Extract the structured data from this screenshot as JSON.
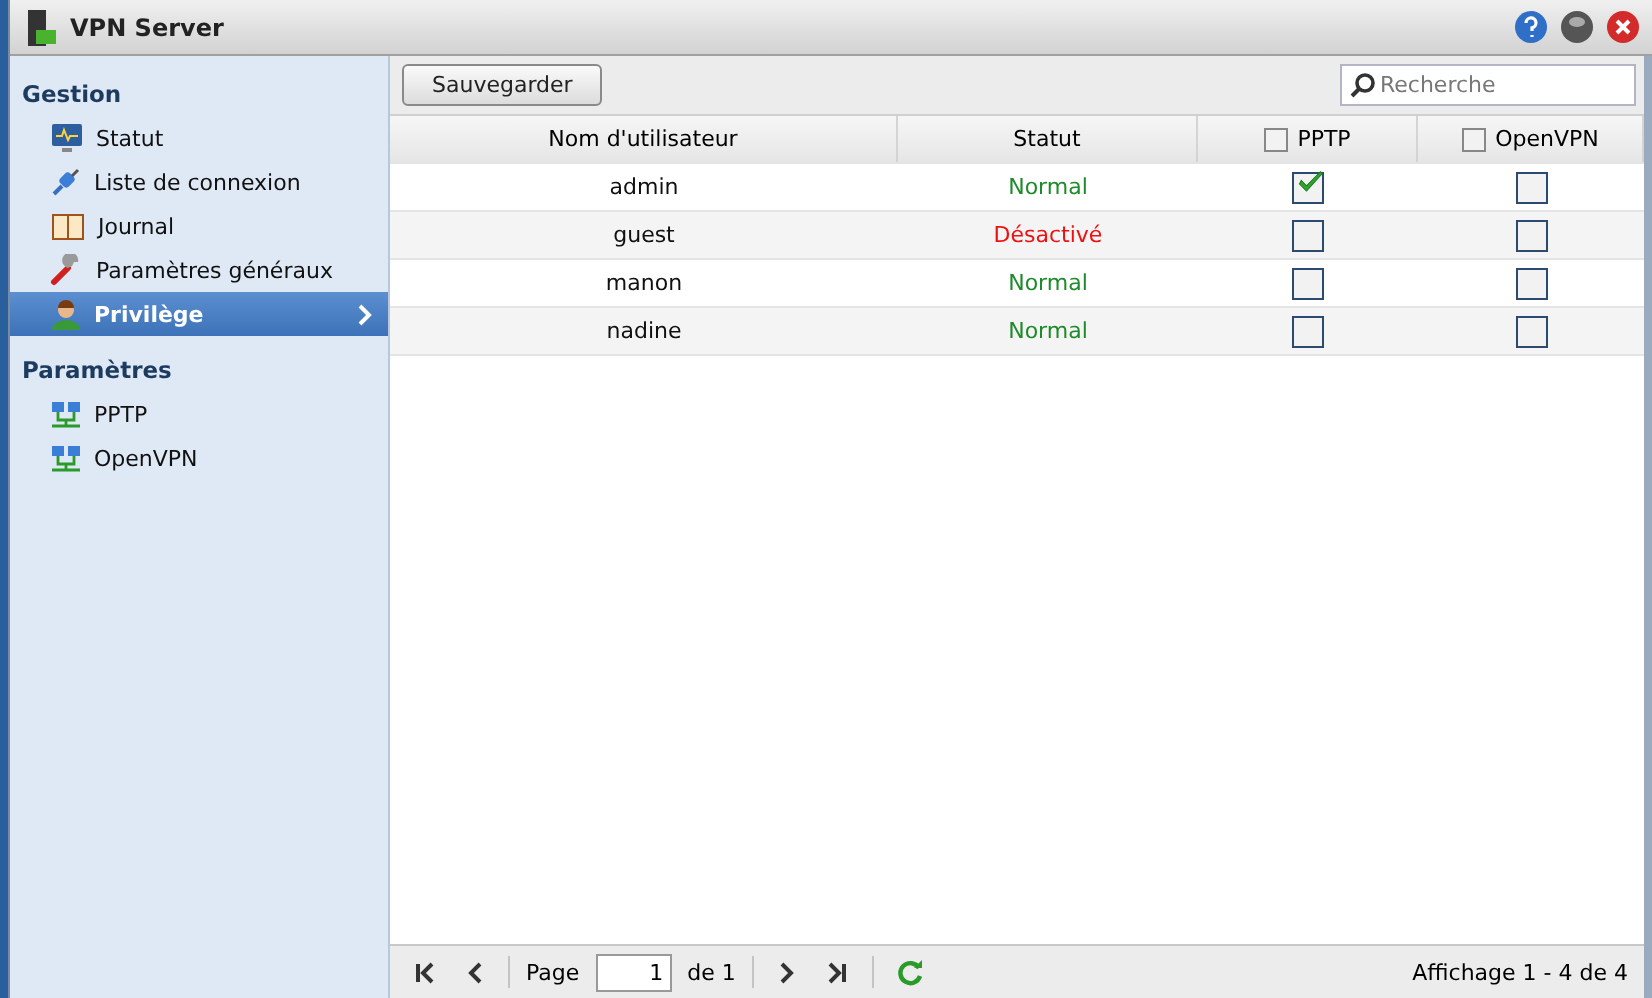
{
  "window": {
    "title": "VPN Server"
  },
  "sidebar": {
    "sections": [
      {
        "title": "Gestion",
        "items": [
          {
            "label": "Statut",
            "kind": "monitor",
            "selected": false
          },
          {
            "label": "Liste de connexion",
            "kind": "plug",
            "selected": false
          },
          {
            "label": "Journal",
            "kind": "book",
            "selected": false
          },
          {
            "label": "Paramètres généraux",
            "kind": "wrench",
            "selected": false
          },
          {
            "label": "Privilège",
            "kind": "user",
            "selected": true
          }
        ]
      },
      {
        "title": "Paramètres",
        "items": [
          {
            "label": "PPTP",
            "kind": "network",
            "selected": false
          },
          {
            "label": "OpenVPN",
            "kind": "network",
            "selected": false
          }
        ]
      }
    ]
  },
  "toolbar": {
    "save": "Sauvegarder",
    "search": {
      "placeholder": "Recherche"
    }
  },
  "table": {
    "columns": [
      {
        "label": "Nom d'utilisateur",
        "kind": "text"
      },
      {
        "label": "Statut",
        "kind": "text"
      },
      {
        "label": "PPTP",
        "kind": "check",
        "checked": false
      },
      {
        "label": "OpenVPN",
        "kind": "check",
        "checked": false
      }
    ],
    "rows": [
      {
        "user": "admin",
        "status": "Normal",
        "color": "#1f8a2a",
        "pptp": true,
        "openvpn": false
      },
      {
        "user": "guest",
        "status": "Désactivé",
        "color": "#ee1111",
        "pptp": false,
        "openvpn": false
      },
      {
        "user": "manon",
        "status": "Normal",
        "color": "#1f8a2a",
        "pptp": false,
        "openvpn": false
      },
      {
        "user": "nadine",
        "status": "Normal",
        "color": "#1f8a2a",
        "pptp": false,
        "openvpn": false
      }
    ]
  },
  "pager": {
    "page_label": "Page",
    "page": "1",
    "of": "de 1",
    "summary": "Affichage 1 - 4 de 4"
  }
}
